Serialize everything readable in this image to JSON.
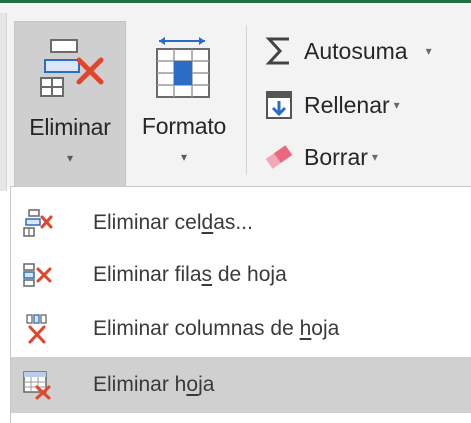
{
  "ribbon": {
    "eliminar": {
      "label": "Eliminar",
      "icon": "delete-cells-icon",
      "caret": "▾"
    },
    "formato": {
      "label": "Formato",
      "icon": "format-cells-icon",
      "caret": "▾"
    },
    "autosuma": {
      "label": "Autosuma",
      "icon": "sigma-icon",
      "caret": "▾"
    },
    "rellenar": {
      "label": "Rellenar",
      "icon": "fill-down-icon",
      "caret": "▾"
    },
    "borrar": {
      "label": "Borrar",
      "icon": "eraser-icon",
      "caret": "▾"
    }
  },
  "menu": {
    "items": [
      {
        "before": "Eliminar cel",
        "accel": "d",
        "after": "as...",
        "icon": "delete-cells-icon"
      },
      {
        "before": "Eliminar fila",
        "accel": "s",
        "after": " de hoja",
        "icon": "delete-rows-icon"
      },
      {
        "before": "Eliminar columnas de ",
        "accel": "h",
        "after": "oja",
        "icon": "delete-columns-icon"
      },
      {
        "before": "Eliminar h",
        "accel": "o",
        "after": "ja",
        "icon": "delete-sheet-icon",
        "hovered": true
      }
    ]
  },
  "colors": {
    "accent_red": "#e2452a",
    "excel_green": "#1e7145",
    "icon_blue": "#2b6cc4"
  }
}
